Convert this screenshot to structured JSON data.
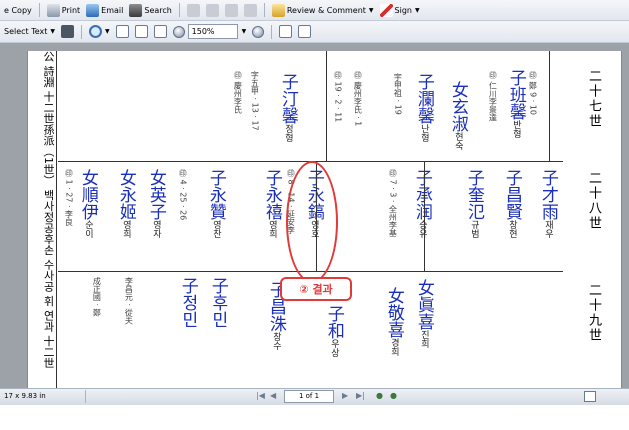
{
  "toolbar1": {
    "copy": "e Copy",
    "print": "Print",
    "email": "Email",
    "search": "Search",
    "review": "Review & Comment",
    "sign": "Sign"
  },
  "toolbar2": {
    "select_text": "Select Text",
    "zoom": "150%"
  },
  "doc": {
    "left_column": "公 詩淵 十二世孫派（1世） 백사정공후손 수사공 휘 연과 十二世",
    "generations": {
      "g27": "二十七世",
      "g28": "二十八世",
      "g29": "二十九世"
    },
    "upper": [
      {
        "name": "子班馨",
        "hangul": "반형"
      },
      {
        "name": "子瀾馨",
        "hangul": "난형"
      },
      {
        "name": "女玄淑",
        "hangul": "현숙"
      },
      {
        "name": "子汀馨",
        "hangul": "정형"
      }
    ],
    "middle": [
      {
        "name": "子才雨",
        "hangul": "재우"
      },
      {
        "name": "子昌賢",
        "hangul": "창현"
      },
      {
        "name": "子奎氾",
        "hangul": "규범"
      },
      {
        "name": "子承润",
        "hangul": "승유"
      },
      {
        "name": "子永鎬",
        "hangul": "영호"
      },
      {
        "name": "子永禧",
        "hangul": "영희"
      },
      {
        "name": "子永贊",
        "hangul": "영찬"
      },
      {
        "name": "女英子",
        "hangul": "영자"
      },
      {
        "name": "女永姬",
        "hangul": "영희"
      },
      {
        "name": "女順伊",
        "hangul": "순이"
      }
    ],
    "lower": [
      {
        "name": "女眞喜",
        "hangul": "진희"
      },
      {
        "name": "女敬喜",
        "hangul": "경희"
      },
      {
        "name": "子和",
        "hangul": "우상"
      },
      {
        "name": "子昌洙",
        "hangul": "창수"
      },
      {
        "name": "子후민",
        "hangul": ""
      },
      {
        "name": "子정민",
        "hangul": ""
      }
    ],
    "annotation": "② 결과"
  },
  "status": {
    "dimensions": "17 x 9.83 in",
    "page": "1 of 1"
  }
}
